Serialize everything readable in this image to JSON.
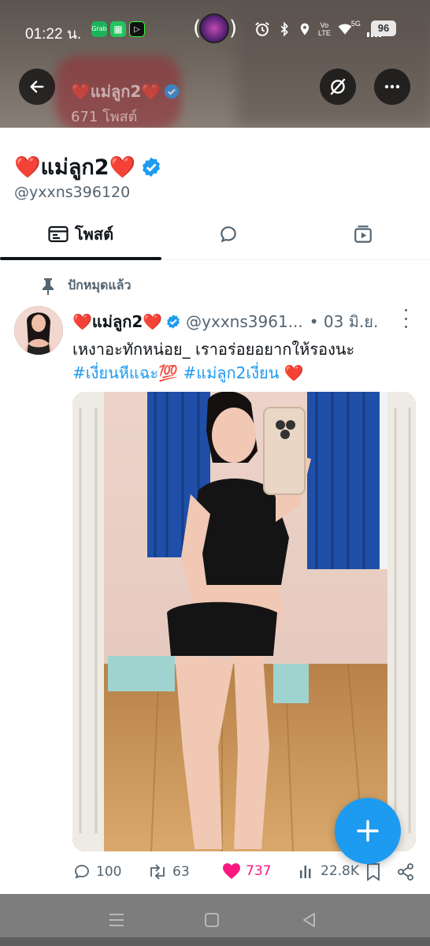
{
  "status_bar": {
    "time": "01:22 น.",
    "apps": [
      "Grab",
      "LINE",
      "▷"
    ],
    "volte": "Vo\nLTE",
    "network": "5G",
    "battery": "96"
  },
  "header": {
    "display_name": "❤️แม่ลูก2❤️",
    "post_count": "671 โพสต์"
  },
  "profile": {
    "display_name": "❤️แม่ลูก2❤️",
    "handle": "@yxxns396120"
  },
  "tabs": [
    {
      "label": "โพสต์",
      "icon": "posts-icon",
      "active": true
    },
    {
      "label": "",
      "icon": "replies-icon",
      "active": false
    },
    {
      "label": "",
      "icon": "media-icon",
      "active": false
    }
  ],
  "pinned_label": "ปักหมุดแล้ว",
  "tweet": {
    "name": "❤️แม่ลูก2❤️",
    "handle": "@yxxns3961...",
    "date": "• 03 มิ.ย.",
    "text": "เหงาอะทักหน่อย_ เราอร่อยอยากให้รองนะ",
    "hashtag1": "#เงี่ยนหีแฉะ💯",
    "hashtag2": "#แม่ลูก2เงี่ยน",
    "emoji_tail": "❤️"
  },
  "actions": {
    "replies": "100",
    "reposts": "63",
    "likes": "737",
    "views": "22.8K"
  },
  "colors": {
    "accent": "#1d9bf0",
    "like": "#f91880",
    "text_primary": "#0f1419",
    "text_secondary": "#536471"
  }
}
